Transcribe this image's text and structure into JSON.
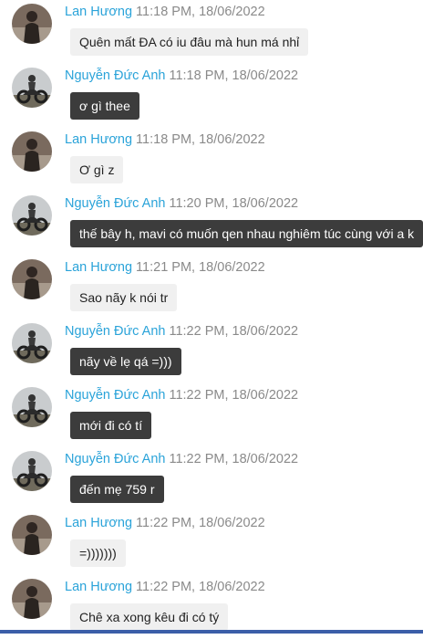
{
  "messages": [
    {
      "sender": "Lan Hương",
      "time": "11:18 PM, 18/06/2022",
      "text": "Quên mất ĐA có iu đâu mà hun má nhỉ",
      "style": "light",
      "avatar": "lan"
    },
    {
      "sender": "Nguyễn Đức Anh",
      "time": "11:18 PM, 18/06/2022",
      "text": "ơ gì thee",
      "style": "dark",
      "avatar": "anh"
    },
    {
      "sender": "Lan Hương",
      "time": "11:18 PM, 18/06/2022",
      "text": "Ơ gì z",
      "style": "light",
      "avatar": "lan"
    },
    {
      "sender": "Nguyễn Đức Anh",
      "time": "11:20 PM, 18/06/2022",
      "text": "thế bây h, mavi có muốn qen nhau nghiêm túc cùng với a k",
      "style": "dark",
      "avatar": "anh"
    },
    {
      "sender": "Lan Hương",
      "time": "11:21 PM, 18/06/2022",
      "text": "Sao nãy k nói tr",
      "style": "light",
      "avatar": "lan"
    },
    {
      "sender": "Nguyễn Đức Anh",
      "time": "11:22 PM, 18/06/2022",
      "text": "nãy về lẹ qá =)))",
      "style": "dark",
      "avatar": "anh"
    },
    {
      "sender": "Nguyễn Đức Anh",
      "time": "11:22 PM, 18/06/2022",
      "text": "mới đi có tí",
      "style": "dark",
      "avatar": "anh"
    },
    {
      "sender": "Nguyễn Đức Anh",
      "time": "11:22 PM, 18/06/2022",
      "text": "đến mẹ 759 r",
      "style": "dark",
      "avatar": "anh"
    },
    {
      "sender": "Lan Hương",
      "time": "11:22 PM, 18/06/2022",
      "text": "=)))))))",
      "style": "light",
      "avatar": "lan"
    },
    {
      "sender": "Lan Hương",
      "time": "11:22 PM, 18/06/2022",
      "text": "Chê xa xong kêu đi có tý",
      "style": "light",
      "avatar": "lan"
    }
  ],
  "colors": {
    "sender_name": "#2aa3d9",
    "timestamp": "#8a8a8a",
    "bubble_light": "#f0f0f0",
    "bubble_dark": "#3c3c3c",
    "bottom_bar": "#3b5ea8"
  },
  "avatars": {
    "lan": "avatar-woman-photo",
    "anh": "avatar-motorbike-photo"
  }
}
